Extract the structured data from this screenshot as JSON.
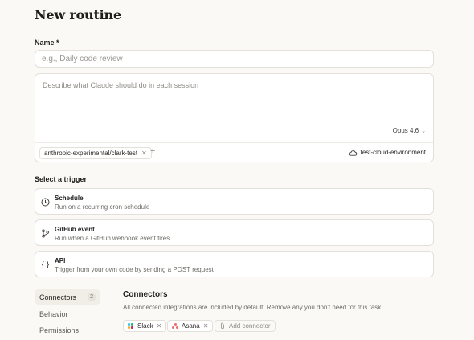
{
  "page": {
    "title": "New routine"
  },
  "name_field": {
    "label": "Name *",
    "placeholder": "e.g., Daily code review"
  },
  "prompt": {
    "placeholder": "Describe what Claude should do in each session",
    "model": "Opus 4.6",
    "repo": "anthropic-experimental/clark-test",
    "environment": "test-cloud-environment"
  },
  "trigger": {
    "label": "Select a trigger",
    "options": [
      {
        "name": "Schedule",
        "description": "Run on a recurring cron schedule",
        "icon": "clock-icon"
      },
      {
        "name": "GitHub event",
        "description": "Run when a GitHub webhook event fires",
        "icon": "git-branch-icon"
      },
      {
        "name": "API",
        "description": "Trigger from your own code by sending a POST request",
        "icon": "braces-icon"
      }
    ]
  },
  "sidenav": {
    "items": [
      {
        "label": "Connectors",
        "badge": "2"
      },
      {
        "label": "Behavior"
      },
      {
        "label": "Permissions"
      }
    ]
  },
  "connectors": {
    "title": "Connectors",
    "description": "All connected integrations are included by default. Remove any you don't need for this task.",
    "items": [
      {
        "label": "Slack",
        "icon": "slack-icon"
      },
      {
        "label": "Asana",
        "icon": "asana-icon"
      }
    ],
    "add_label": "Add connector"
  },
  "colors": {
    "background": "#faf9f5",
    "border": "#e2e0d8",
    "active_nav": "#f0eee6"
  }
}
